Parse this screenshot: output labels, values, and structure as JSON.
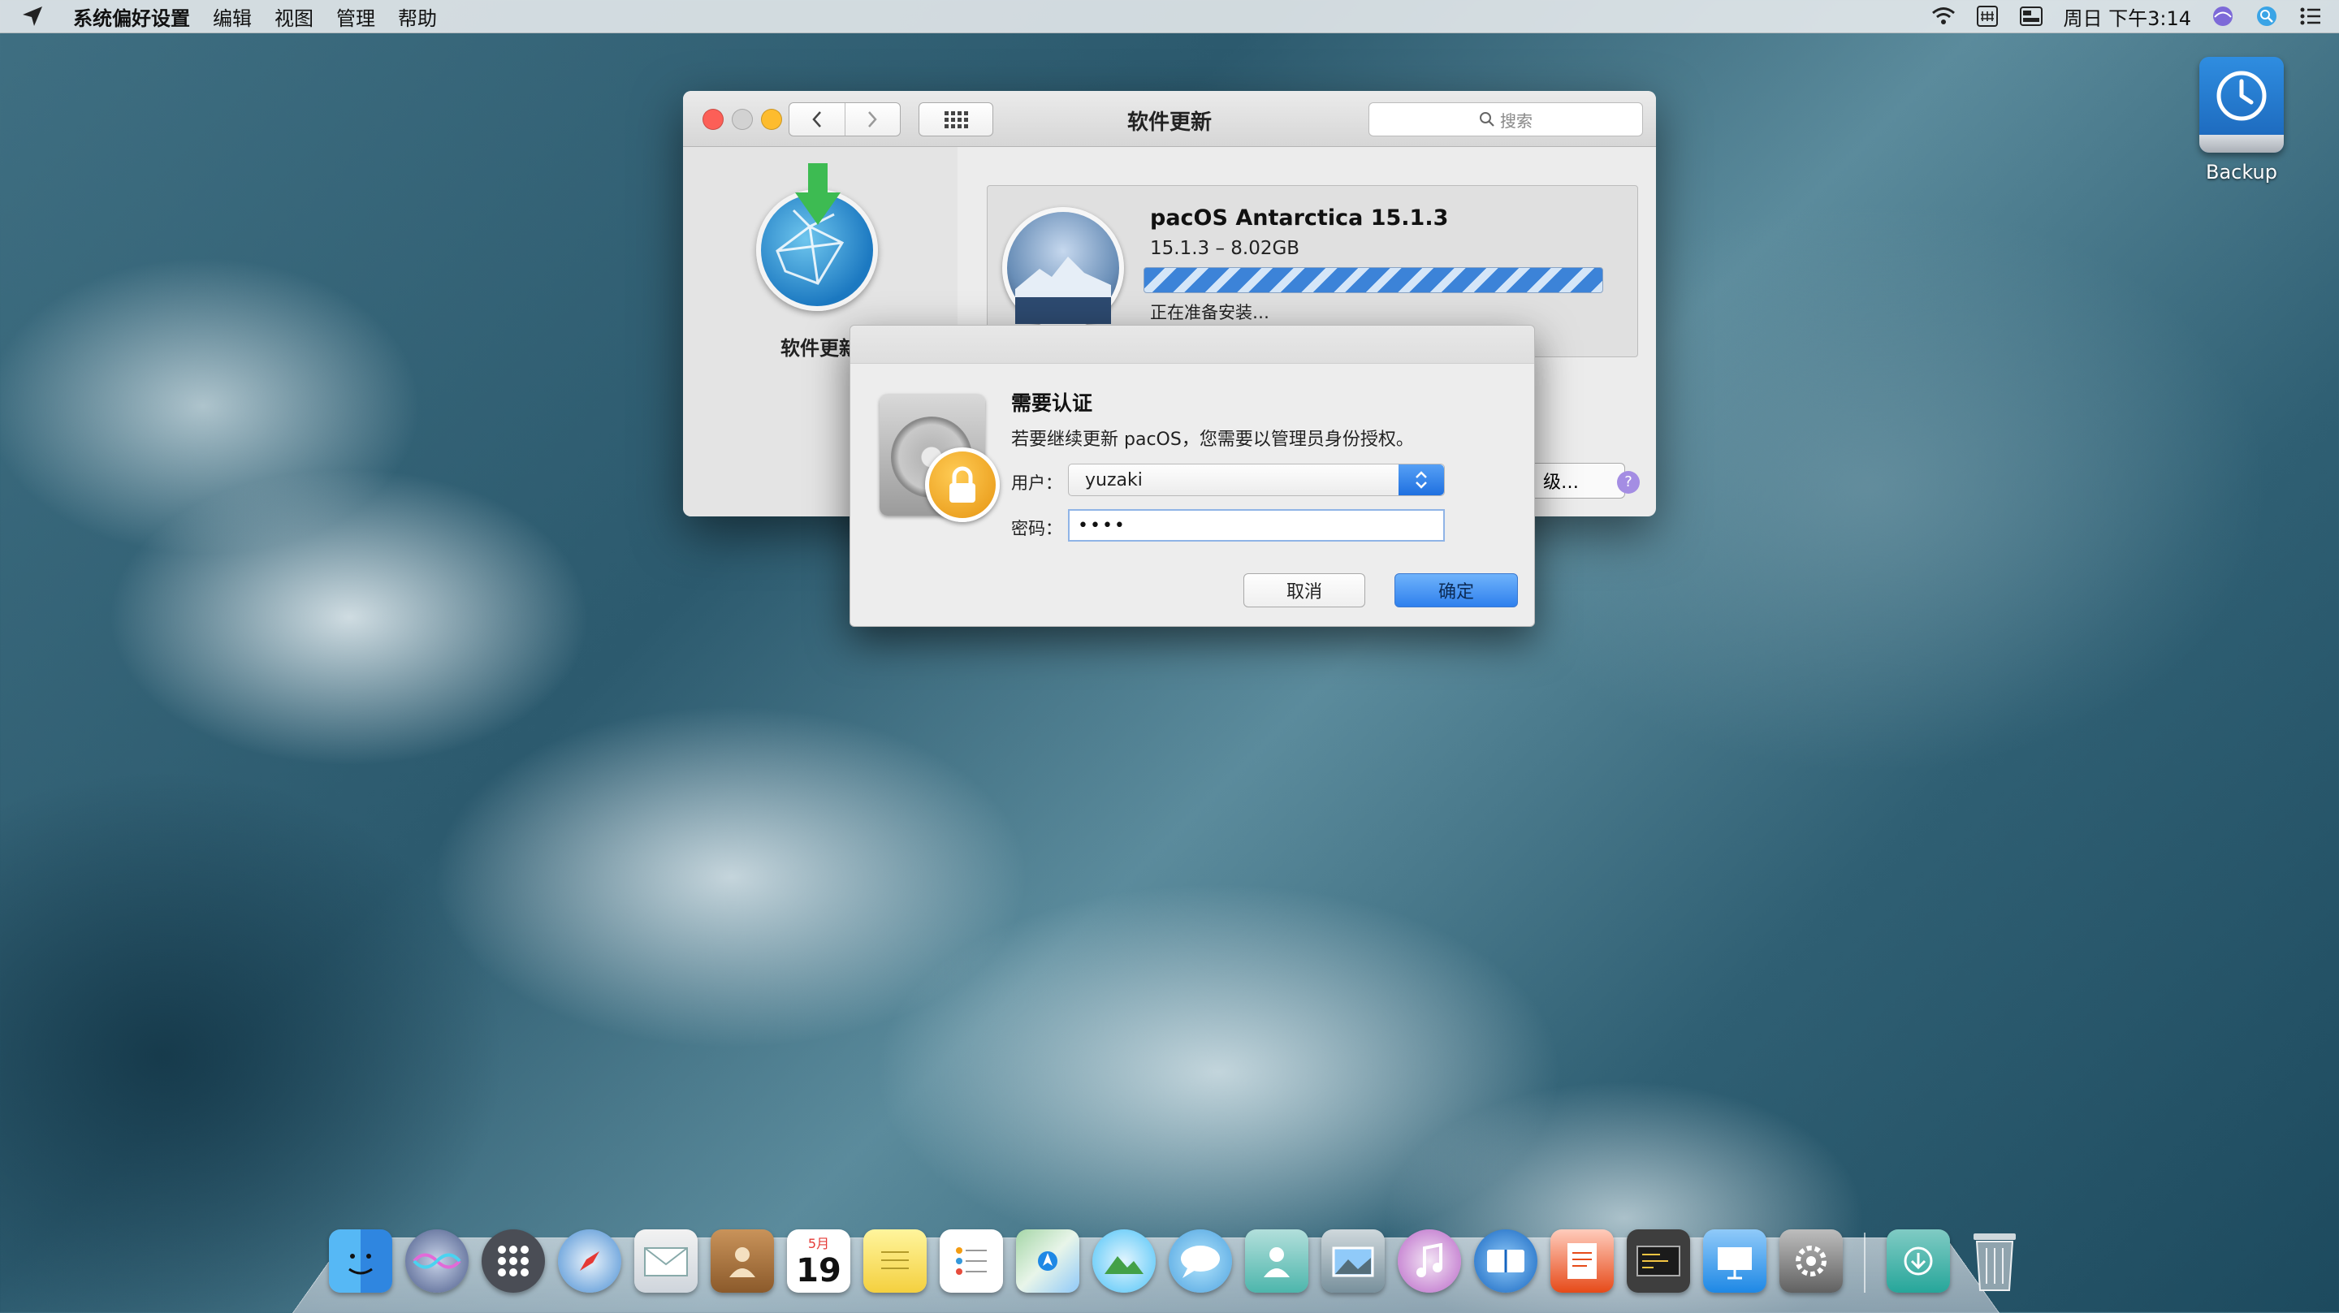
{
  "menubar": {
    "app_name": "系统偏好设置",
    "items": [
      "编辑",
      "视图",
      "管理",
      "帮助"
    ],
    "clock": "周日 下午3:14",
    "icons": [
      "wifi-icon",
      "input-method-icon",
      "control-strip-icon",
      "siri-icon",
      "spotlight-icon",
      "notification-center-icon"
    ]
  },
  "desktop": {
    "drive_label": "Backup"
  },
  "window": {
    "title": "软件更新",
    "search_placeholder": "搜索",
    "sidebar_label": "软件更新",
    "update": {
      "name": "pacOS Antarctica 15.1.3",
      "size": "15.1.3 – 8.02GB",
      "status": "正在准备安装…",
      "progress_state": "indeterminate"
    },
    "advanced_button_partial": "级…",
    "help_label": "?"
  },
  "dialog": {
    "title": "需要认证",
    "message": "若要继续更新 pacOS，您需要以管理员身份授权。",
    "user_label": "用户：",
    "user_value": "yuzaki",
    "password_label": "密码：",
    "password_mask": "••••",
    "cancel": "取消",
    "ok": "确定"
  },
  "dock": {
    "calendar_month": "5月",
    "calendar_day": "19",
    "apps": [
      "finder-icon",
      "siri-icon",
      "launchpad-icon",
      "safari-icon",
      "mail-icon",
      "contacts-icon",
      "calendar-icon",
      "notes-icon",
      "reminders-icon",
      "maps-icon",
      "photos-icon",
      "messages-icon",
      "facetime-icon",
      "preview-icon",
      "music-icon",
      "books-icon",
      "pages-icon",
      "console-icon",
      "keynote-icon",
      "system-preferences-icon",
      "downloads-icon",
      "trash-icon"
    ]
  },
  "colors": {
    "accent": "#2f80ed",
    "progress_stripe": "#3c83d8",
    "lock": "#f0a81f"
  }
}
